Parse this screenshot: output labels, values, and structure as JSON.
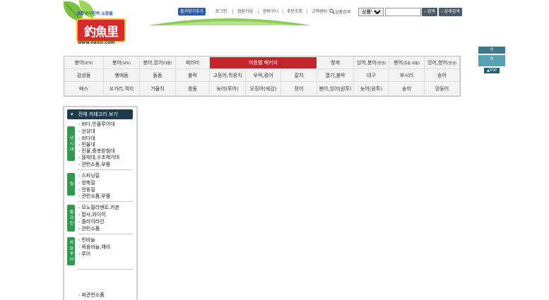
{
  "header": {
    "tagline": "생활낚시인의 쇼핑몰",
    "logo_text": "釣魚里",
    "url": "www.naxsi.com",
    "bookmark": "즐겨찾기추가",
    "links": [
      "로그인",
      "회원가입",
      "장바구니",
      "주문조회",
      "고객센터"
    ],
    "search_label": "상품검색",
    "search_select": "상품명",
    "search_btn": "검색",
    "detail_btn": "상세검색"
  },
  "right_widget": {
    "top": "0",
    "mid": "0",
    "bottom": "▲TOP"
  },
  "banner": "어종별 패키지",
  "categories": {
    "row1": [
      {
        "label": "붕어",
        "sub": "(바닥)"
      },
      {
        "label": "붕어",
        "sub": "(보트)"
      },
      {
        "label": "붕어,잉어",
        "sub": "(대물)"
      },
      {
        "label": "찌라미",
        "sub": ""
      },
      {
        "label": "향게",
        "sub": ""
      },
      {
        "label": "잉어,붕어",
        "sub": "(방생)"
      },
      {
        "label": "붕어",
        "sub": "(중층,내림)"
      },
      {
        "label": "잉어,향어",
        "sub": "(방생)"
      }
    ],
    "row2": [
      "감성돔",
      "벵에돔",
      "돌돔",
      "볼락",
      "고등어,학꽁치",
      "우럭,광어",
      "갈치",
      "열기,볼락",
      "대구",
      "부시리",
      "숭어"
    ],
    "row3": [
      "배스",
      "쏘가리,꺽지",
      "가물치",
      "참돔",
      "농어(루어)",
      "오징어(에깅)",
      "장어",
      "붕어,잉어(원투)",
      "농어(원투)",
      "숭어",
      "망둥어"
    ]
  },
  "sidebar": {
    "header": "전체 카테고리 보기",
    "groups": [
      {
        "tab": "낚시대",
        "items": [
          "바다,민물루어대",
          "선상대",
          "바다대",
          "민물대",
          "민물,중층받침대",
          "뜰채대,수초제거대",
          "관련소품,부품"
        ]
      },
      {
        "tab": "릴",
        "items": [
          "스피닝릴",
          "양축릴",
          "전동릴",
          "관련소품,부품"
        ]
      },
      {
        "tab": "줄라인",
        "items": [
          "모노필라멘트,카본",
          "합사,와이어",
          "플라이라인",
          "관련소품"
        ]
      },
      {
        "tab": "바늘루어",
        "items": [
          "민바늘",
          "묶음바늘,채비",
          "루어"
        ]
      }
    ],
    "footer_item": "찌관련소품"
  },
  "colors": {
    "accent_red": "#c1262b",
    "nav_green": "#2f9a4f",
    "header_dark": "#1d3b4a"
  }
}
